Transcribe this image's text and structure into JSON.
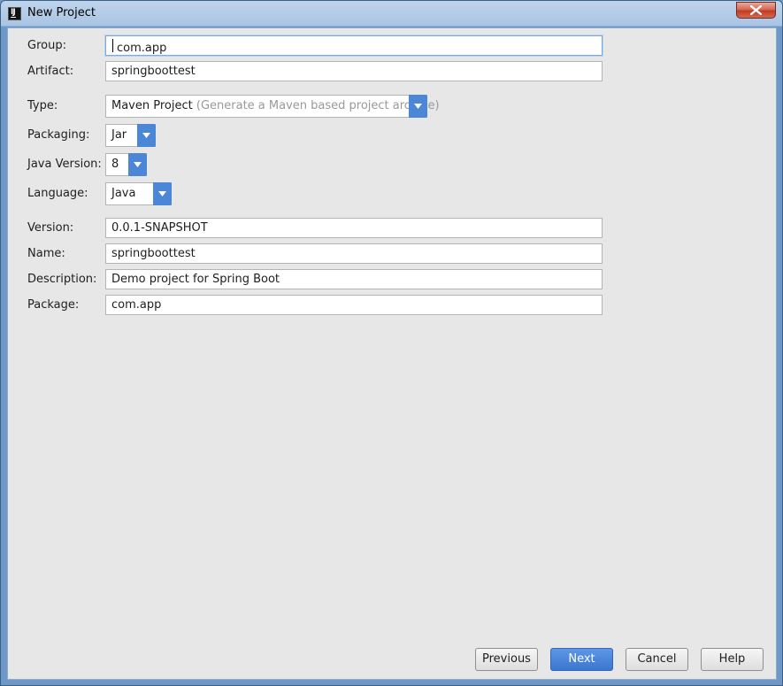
{
  "window": {
    "title": "New Project"
  },
  "form": {
    "group": {
      "label": "Group:",
      "value": "com.app"
    },
    "artifact": {
      "label": "Artifact:",
      "value": "springboottest"
    },
    "type": {
      "label": "Type:",
      "value": "Maven Project",
      "hint": "(Generate a Maven based project archive)"
    },
    "packaging": {
      "label": "Packaging:",
      "value": "Jar"
    },
    "java_version": {
      "label": "Java Version:",
      "value": "8"
    },
    "language": {
      "label": "Language:",
      "value": "Java"
    },
    "version": {
      "label": "Version:",
      "value": "0.0.1-SNAPSHOT"
    },
    "name": {
      "label": "Name:",
      "value": "springboottest"
    },
    "description": {
      "label": "Description:",
      "value": "Demo project for Spring Boot"
    },
    "package": {
      "label": "Package:",
      "value": "com.app"
    }
  },
  "buttons": {
    "previous": "Previous",
    "next": "Next",
    "cancel": "Cancel",
    "help": "Help"
  },
  "icons": {
    "app": "intellij-idea-icon",
    "close": "close-icon",
    "dropdown": "chevron-down-icon"
  },
  "colors": {
    "accent": "#4c86d6",
    "primary_button": "#3c76cf",
    "content_bg": "#e7e7e7"
  }
}
